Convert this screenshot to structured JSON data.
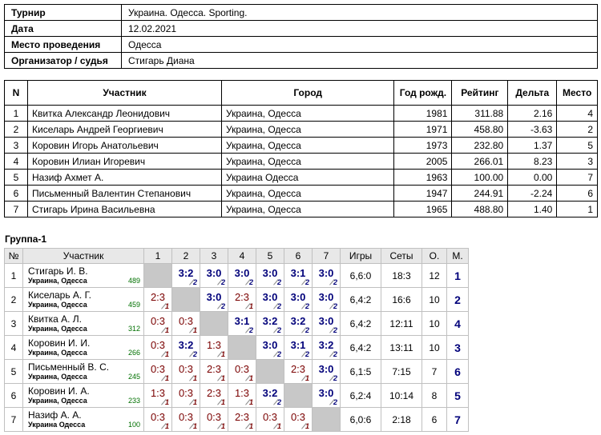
{
  "info": [
    {
      "key": "Турнир",
      "value": "Украина. Одесса. Sporting."
    },
    {
      "key": "Дата",
      "value": "12.02.2021"
    },
    {
      "key": "Место проведения",
      "value": "Одесса"
    },
    {
      "key": "Организатор / судья",
      "value": "Стигарь Диана"
    }
  ],
  "participants": {
    "headers": [
      "N",
      "Участник",
      "Город",
      "Год рожд.",
      "Рейтинг",
      "Дельта",
      "Место"
    ],
    "rows": [
      [
        "1",
        "Квитка Александр Леонидович",
        "Украина, Одесса",
        "1981",
        "311.88",
        "2.16",
        "4"
      ],
      [
        "2",
        "Киселарь Андрей Георгиевич",
        "Украина, Одесса",
        "1971",
        "458.80",
        "-3.63",
        "2"
      ],
      [
        "3",
        "Коровин Игорь Анатольевич",
        "Украина, Одесса",
        "1973",
        "232.80",
        "1.37",
        "5"
      ],
      [
        "4",
        "Коровин Илиан Игоревич",
        "Украина, Одесса",
        "2005",
        "266.01",
        "8.23",
        "3"
      ],
      [
        "5",
        "Назиф Ахмет А.",
        "Украина Одесса",
        "1963",
        "100.00",
        "0.00",
        "7"
      ],
      [
        "6",
        "Письменный Валентин Степанович",
        "Украина, Одесса",
        "1947",
        "244.91",
        "-2.24",
        "6"
      ],
      [
        "7",
        "Стигарь Ирина Васильевна",
        "Украина, Одесса",
        "1965",
        "488.80",
        "1.40",
        "1"
      ]
    ]
  },
  "group": {
    "title": "Группа-1",
    "headers": [
      "№",
      "Участник",
      "1",
      "2",
      "3",
      "4",
      "5",
      "6",
      "7",
      "Игры",
      "Сеты",
      "О.",
      "М."
    ],
    "rows": [
      {
        "n": "1",
        "name": "Стигарь И. В.",
        "city": "Украина, Одесса",
        "rating": "489",
        "cells": [
          null,
          {
            "s": "3:2",
            "o": "2",
            "w": true
          },
          {
            "s": "3:0",
            "o": "2",
            "w": true
          },
          {
            "s": "3:0",
            "o": "2",
            "w": true
          },
          {
            "s": "3:0",
            "o": "2",
            "w": true
          },
          {
            "s": "3:1",
            "o": "2",
            "w": true
          },
          {
            "s": "3:0",
            "o": "2",
            "w": true
          }
        ],
        "games": "6,6:0",
        "sets": "18:3",
        "points": "12",
        "place": "1"
      },
      {
        "n": "2",
        "name": "Киселарь А. Г.",
        "city": "Украина, Одесса",
        "rating": "459",
        "cells": [
          {
            "s": "2:3",
            "o": "1",
            "w": false
          },
          null,
          {
            "s": "3:0",
            "o": "2",
            "w": true
          },
          {
            "s": "2:3",
            "o": "1",
            "w": false
          },
          {
            "s": "3:0",
            "o": "2",
            "w": true
          },
          {
            "s": "3:0",
            "o": "2",
            "w": true
          },
          {
            "s": "3:0",
            "o": "2",
            "w": true
          }
        ],
        "games": "6,4:2",
        "sets": "16:6",
        "points": "10",
        "place": "2"
      },
      {
        "n": "3",
        "name": "Квитка А. Л.",
        "city": "Украина, Одесса",
        "rating": "312",
        "cells": [
          {
            "s": "0:3",
            "o": "1",
            "w": false
          },
          {
            "s": "0:3",
            "o": "1",
            "w": false
          },
          null,
          {
            "s": "3:1",
            "o": "2",
            "w": true
          },
          {
            "s": "3:2",
            "o": "2",
            "w": true
          },
          {
            "s": "3:2",
            "o": "2",
            "w": true
          },
          {
            "s": "3:0",
            "o": "2",
            "w": true
          }
        ],
        "games": "6,4:2",
        "sets": "12:11",
        "points": "10",
        "place": "4"
      },
      {
        "n": "4",
        "name": "Коровин И. И.",
        "city": "Украина, Одесса",
        "rating": "266",
        "cells": [
          {
            "s": "0:3",
            "o": "1",
            "w": false
          },
          {
            "s": "3:2",
            "o": "2",
            "w": true
          },
          {
            "s": "1:3",
            "o": "1",
            "w": false
          },
          null,
          {
            "s": "3:0",
            "o": "2",
            "w": true
          },
          {
            "s": "3:1",
            "o": "2",
            "w": true
          },
          {
            "s": "3:2",
            "o": "2",
            "w": true
          }
        ],
        "games": "6,4:2",
        "sets": "13:11",
        "points": "10",
        "place": "3"
      },
      {
        "n": "5",
        "name": "Письменный В. С.",
        "city": "Украина, Одесса",
        "rating": "245",
        "cells": [
          {
            "s": "0:3",
            "o": "1",
            "w": false
          },
          {
            "s": "0:3",
            "o": "1",
            "w": false
          },
          {
            "s": "2:3",
            "o": "1",
            "w": false
          },
          {
            "s": "0:3",
            "o": "1",
            "w": false
          },
          null,
          {
            "s": "2:3",
            "o": "1",
            "w": false
          },
          {
            "s": "3:0",
            "o": "2",
            "w": true
          }
        ],
        "games": "6,1:5",
        "sets": "7:15",
        "points": "7",
        "place": "6"
      },
      {
        "n": "6",
        "name": "Коровин И. А.",
        "city": "Украина, Одесса",
        "rating": "233",
        "cells": [
          {
            "s": "1:3",
            "o": "1",
            "w": false
          },
          {
            "s": "0:3",
            "o": "1",
            "w": false
          },
          {
            "s": "2:3",
            "o": "1",
            "w": false
          },
          {
            "s": "1:3",
            "o": "1",
            "w": false
          },
          {
            "s": "3:2",
            "o": "2",
            "w": true
          },
          null,
          {
            "s": "3:0",
            "o": "2",
            "w": true
          }
        ],
        "games": "6,2:4",
        "sets": "10:14",
        "points": "8",
        "place": "5"
      },
      {
        "n": "7",
        "name": "Назиф А. А.",
        "city": "Украина Одесса",
        "rating": "100",
        "cells": [
          {
            "s": "0:3",
            "o": "1",
            "w": false
          },
          {
            "s": "0:3",
            "o": "1",
            "w": false
          },
          {
            "s": "0:3",
            "o": "1",
            "w": false
          },
          {
            "s": "2:3",
            "o": "1",
            "w": false
          },
          {
            "s": "0:3",
            "o": "1",
            "w": false
          },
          {
            "s": "0:3",
            "o": "1",
            "w": false
          },
          null
        ],
        "games": "6,0:6",
        "sets": "2:18",
        "points": "6",
        "place": "7"
      }
    ]
  }
}
